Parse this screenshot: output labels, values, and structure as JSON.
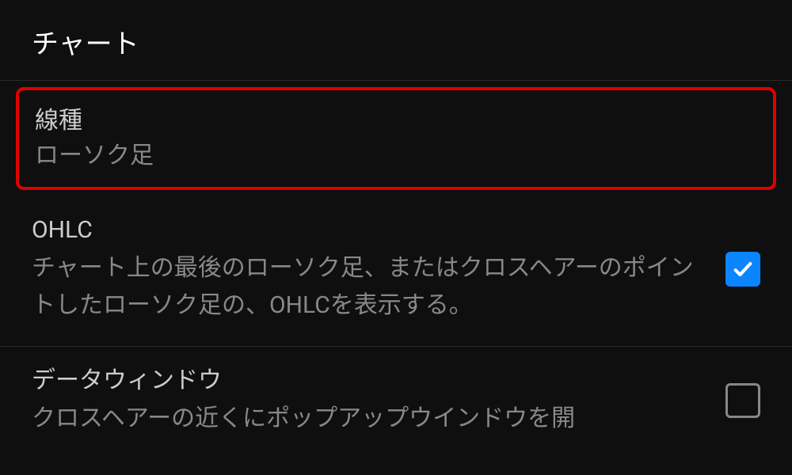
{
  "section": {
    "header": "チャート"
  },
  "settings": {
    "lineType": {
      "title": "線種",
      "value": "ローソク足"
    },
    "ohlc": {
      "title": "OHLC",
      "description": "チャート上の最後のローソク足、またはクロスヘアーのポイントしたローソク足の、OHLCを表示する。",
      "checked": true
    },
    "dataWindow": {
      "title": "データウィンドウ",
      "description": "クロスヘアーの近くにポップアップウインドウを開",
      "checked": false
    }
  }
}
